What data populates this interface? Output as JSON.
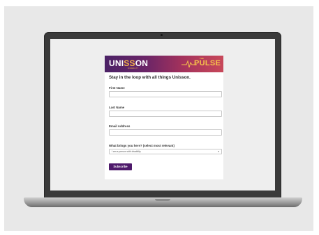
{
  "brand": {
    "unisson_text_a": "UNI",
    "unisson_text_b": "SS",
    "unisson_text_c": "ON",
    "unisson_sub": "DISABILITY",
    "pulse_the": "THE",
    "pulse_text": "PULSE"
  },
  "form": {
    "heading": "Stay in the loop with all things Unisson.",
    "first_name_label": "First Name",
    "last_name_label": "Last Name",
    "email_label": "Email Address",
    "reason_label": "What brings you here? (select most relevant)",
    "reason_selected": "I am a person with disability",
    "subscribe_label": "Subscribe"
  },
  "colors": {
    "banner_start": "#4b2266",
    "banner_end": "#c8485a",
    "accent": "#f6c24b",
    "button": "#4e1a6b"
  }
}
